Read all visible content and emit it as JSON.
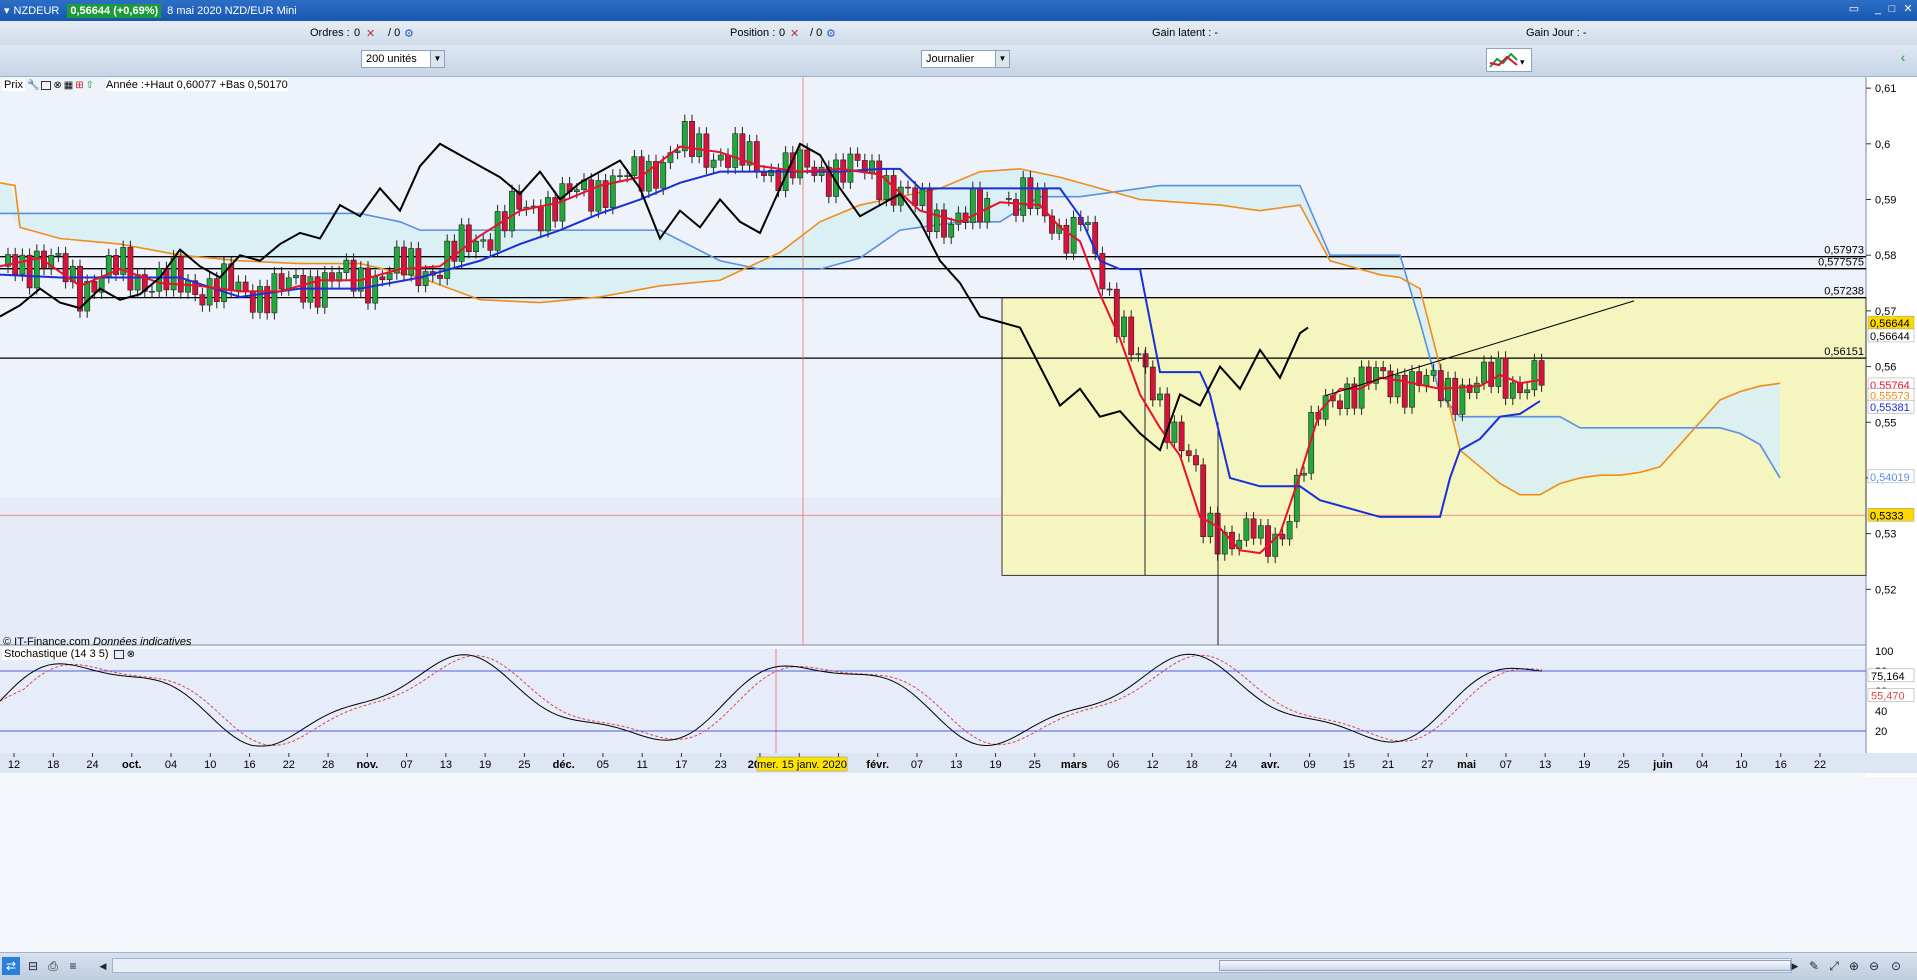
{
  "window": {
    "title": "NZDEUR",
    "price_badge": "0,56644 (+0,69%)",
    "subtitle": "8 mai 2020 NZD/EUR Mini"
  },
  "infobar": {
    "orders_label": "Ordres :",
    "orders_value": "0",
    "orders_total": "/ 0",
    "position_label": "Position :",
    "position_value": "0",
    "position_total": "/ 0",
    "unrealized_label": "Gain latent : -",
    "day_gain_label": "Gain Jour : -"
  },
  "toolbar": {
    "units_select": "200 unités",
    "period_select": "Journalier"
  },
  "price_panel": {
    "label": "Prix",
    "year_info": "Année :+Haut 0,60077 +Bas 0,50170",
    "copyright": "© IT-Finance.com",
    "disclaimer": "Données indicatives",
    "y_ticks": [
      "0,61",
      "0,6",
      "0,59",
      "0,58",
      "0,57",
      "0,56",
      "0,55",
      "0,54",
      "0,53",
      "0,52"
    ],
    "horizontal_lines": [
      {
        "label": "0,57973",
        "value": 0.57973
      },
      {
        "label": "0,577575",
        "value": 0.577575
      },
      {
        "label": "0,57238",
        "value": 0.57238
      },
      {
        "label": "0,56151",
        "value": 0.56151
      }
    ],
    "price_tags": [
      {
        "label": "0,56644",
        "color": "#ffd800",
        "text_color": "#000000"
      },
      {
        "label": "0,56644",
        "color": "#ffffff",
        "text_color": "#000000"
      },
      {
        "label": "0,55764",
        "color": "#ffffff",
        "text_color": "#e8102c"
      },
      {
        "label": "0,55573",
        "color": "#ffffff",
        "text_color": "#f08c1a"
      },
      {
        "label": "0,55381",
        "color": "#ffffff",
        "text_color": "#1a2fd8"
      },
      {
        "label": "0,54019",
        "color": "#ffffff",
        "text_color": "#5b8fe0"
      },
      {
        "label": "0,5333",
        "color": "#ffd800",
        "text_color": "#000000"
      }
    ]
  },
  "stoch_panel": {
    "label": "Stochastique (14 3 5)",
    "y_ticks": [
      "100",
      "80",
      "60",
      "40",
      "20"
    ],
    "k_value": "75,164",
    "d_value": "55,470"
  },
  "x_axis": {
    "labels": [
      "12",
      "18",
      "24",
      "oct.",
      "04",
      "10",
      "16",
      "22",
      "28",
      "nov.",
      "07",
      "13",
      "19",
      "25",
      "déc.",
      "05",
      "11",
      "17",
      "23",
      "2020",
      "2",
      "28",
      "févr.",
      "07",
      "13",
      "19",
      "25",
      "mars",
      "06",
      "12",
      "18",
      "24",
      "avr.",
      "09",
      "15",
      "21",
      "27",
      "mai",
      "07",
      "13",
      "19",
      "25",
      "juin",
      "04",
      "10",
      "16",
      "22"
    ],
    "crosshair_date": "mer. 15 janv. 2020"
  },
  "chart_data": {
    "type": "candlestick",
    "instrument": "NZD/EUR",
    "ylim": [
      0.51,
      0.612
    ],
    "levels": [
      0.57973,
      0.577575,
      0.57238,
      0.56151,
      0.5333
    ],
    "last_close": 0.56644,
    "colors": {
      "up": "#22a83a",
      "down": "#d8123a",
      "tenkan": "#e8102c",
      "kijun": "#1a2fd8",
      "chikou": "#000000",
      "ssa": "#f08c1a",
      "ssb": "#5b8fe0",
      "cloud": "#d8f0f4",
      "rect": "#f5f5c0"
    },
    "candles_note": "daily OHLC, Sep 2019 - May 2020",
    "stochastic": {
      "k_last": 75.164,
      "d_last": 55.47,
      "levels": [
        20,
        80
      ]
    }
  }
}
